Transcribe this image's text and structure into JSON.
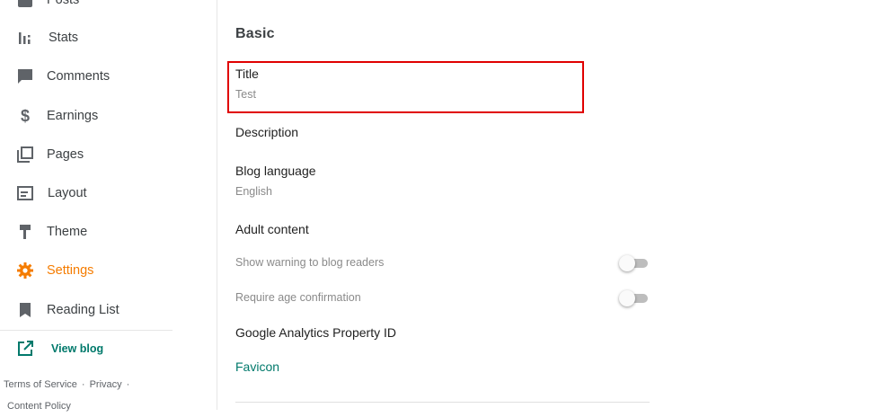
{
  "sidebar": {
    "items": [
      {
        "label": "Posts",
        "icon": "posts-icon"
      },
      {
        "label": "Stats",
        "icon": "stats-icon"
      },
      {
        "label": "Comments",
        "icon": "comment-icon"
      },
      {
        "label": "Earnings",
        "icon": "dollar-icon"
      },
      {
        "label": "Pages",
        "icon": "pages-icon"
      },
      {
        "label": "Layout",
        "icon": "layout-icon"
      },
      {
        "label": "Theme",
        "icon": "paint-roller-icon"
      },
      {
        "label": "Settings",
        "icon": "gear-icon",
        "active": true
      },
      {
        "label": "Reading List",
        "icon": "bookmark-icon"
      }
    ],
    "view_blog": "View blog",
    "footer": {
      "terms": "Terms of Service",
      "privacy": "Privacy",
      "content_policy": "Content Policy",
      "separator": "·"
    }
  },
  "main": {
    "section_title": "Basic",
    "title": {
      "label": "Title",
      "value": "Test"
    },
    "description": {
      "label": "Description"
    },
    "blog_language": {
      "label": "Blog language",
      "value": "English"
    },
    "adult_content": {
      "label": "Adult content"
    },
    "show_warning": {
      "label": "Show warning to blog readers",
      "enabled": false
    },
    "require_age": {
      "label": "Require age confirmation",
      "enabled": false
    },
    "analytics": {
      "label": "Google Analytics Property ID"
    },
    "favicon": {
      "label": "Favicon"
    }
  },
  "colors": {
    "accent_orange": "#f57c00",
    "teal_link": "#00796b",
    "highlight_red": "#e00000",
    "icon_gray": "#5f6368"
  }
}
